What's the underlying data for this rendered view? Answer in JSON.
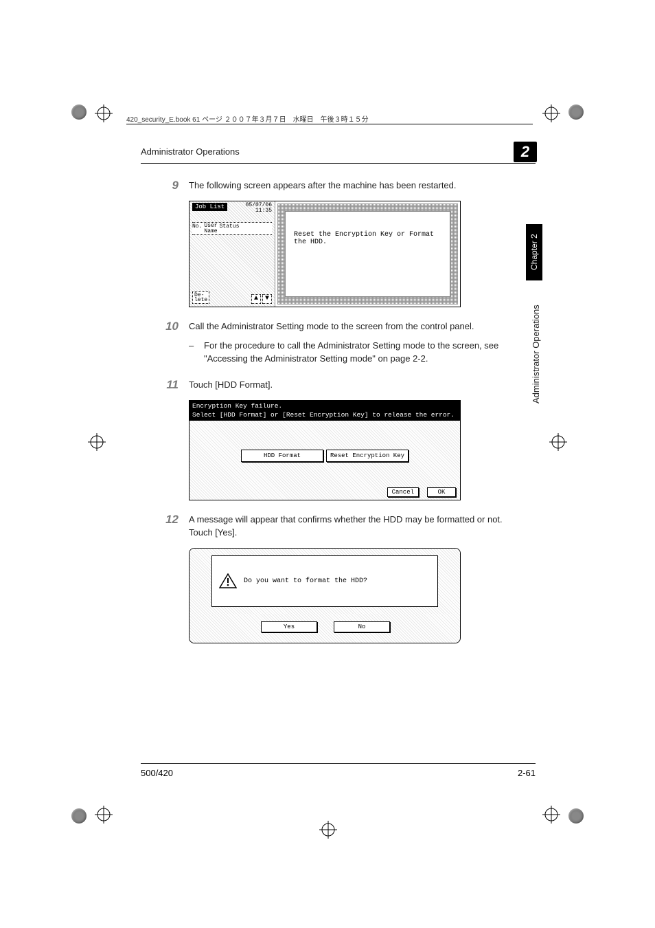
{
  "page_header": "420_security_E.book  61 ページ  ２００７年３月７日　水曜日　午後３時１５分",
  "running_head": "Administrator Operations",
  "chapter_num": "2",
  "side_tab": "Chapter 2",
  "side_label": "Administrator Operations",
  "steps": {
    "s9": {
      "num": "9",
      "text": "The following screen appears after the machine has been restarted."
    },
    "s10": {
      "num": "10",
      "text": "Call the Administrator Setting mode to the screen from the control panel.",
      "bullet": "For the procedure to call the Administrator Setting mode to the screen, see \"Accessing the Administrator Setting mode\" on page 2-2."
    },
    "s11": {
      "num": "11",
      "text": "Touch [HDD Format]."
    },
    "s12": {
      "num": "12",
      "text": "A message will appear that confirms whether the HDD may be formatted or not.",
      "text2": "Touch [Yes]."
    }
  },
  "ss1": {
    "job": "Job\nList",
    "date": "05/07/06",
    "time": "11:35",
    "col1": "No.",
    "col2": "User\nName",
    "col3": "Status",
    "delete": "De-\nlete",
    "msg": "Reset the Encryption Key or Format the HDD."
  },
  "ss2": {
    "line1": "Encryption Key failure.",
    "line2": "Select [HDD Format] or [Reset Encryption Key] to release the error.",
    "btn1": "HDD Format",
    "btn2": "Reset Encryption Key",
    "cancel": "Cancel",
    "ok": "OK"
  },
  "ss3": {
    "msg": "Do you want to format the HDD?",
    "yes": "Yes",
    "no": "No"
  },
  "footer": {
    "left": "500/420",
    "right": "2-61"
  }
}
